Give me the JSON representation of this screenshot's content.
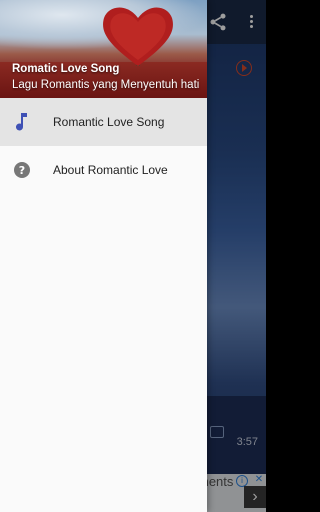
{
  "drawer": {
    "header": {
      "title": "Romatic Love Song",
      "subtitle": "Lagu Romantis yang Menyentuh hati"
    },
    "items": [
      {
        "label": "Romantic Love Song",
        "icon": "music-note-icon",
        "active": true
      },
      {
        "label": "About Romantic Love",
        "icon": "help-icon",
        "active": false
      }
    ]
  },
  "background": {
    "track_duration": "3:57",
    "ad_text": "ments"
  },
  "colors": {
    "accent": "#3f51b5",
    "header_text": "#ffffff",
    "active_item_bg": "#e4e4e4",
    "play_icon": "#d84a2a"
  }
}
